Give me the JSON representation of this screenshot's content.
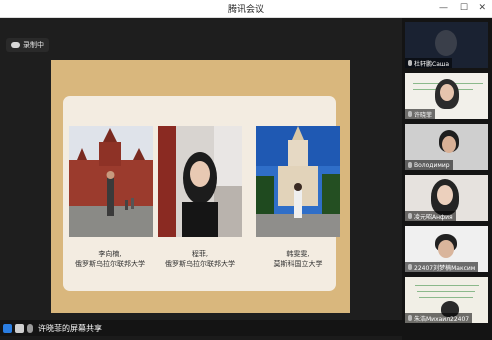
{
  "window": {
    "title": "腾讯会议",
    "min": "—",
    "max": "☐",
    "close": "✕"
  },
  "recording": {
    "label": "录制中",
    "icon": "cloud-icon"
  },
  "slide": {
    "captions": [
      {
        "line1": "李向楠,",
        "line2": "俄罗斯乌拉尔联邦大学"
      },
      {
        "line1": "程菲,",
        "line2": "俄罗斯乌拉尔联邦大学"
      },
      {
        "line1": "韩雯雯,",
        "line2": "莫斯科国立大学"
      }
    ]
  },
  "share": {
    "text": "许晓菲的屏幕共享"
  },
  "participants": [
    {
      "name": "杜轩鹏Саша"
    },
    {
      "name": "许晓菲"
    },
    {
      "name": "Володимир"
    },
    {
      "name": "凌元昭Анфия"
    },
    {
      "name": "22407刘梦楠Максим"
    },
    {
      "name": "朱浩Михаил22407"
    }
  ],
  "colors": {
    "accent": "#2a7de1",
    "slide_bg": "#d9b77d",
    "panel_bg": "#f3ece1"
  }
}
